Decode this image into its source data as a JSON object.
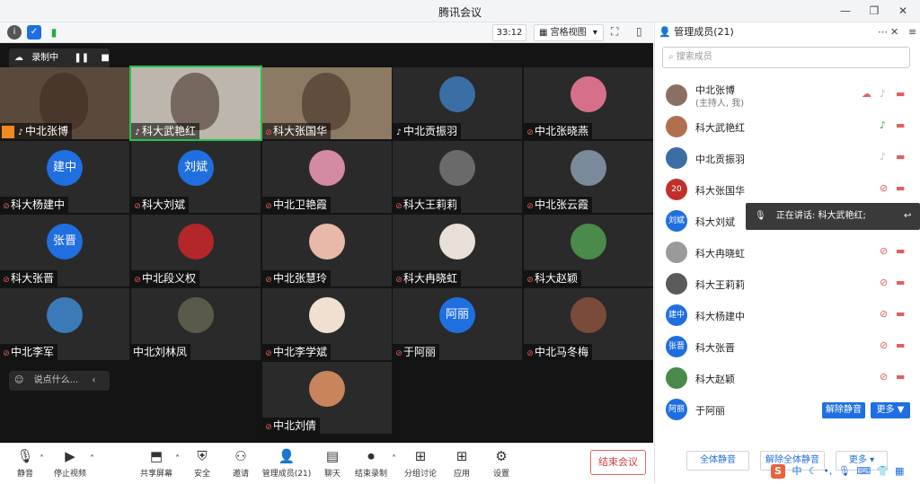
{
  "window": {
    "title": "腾讯会议"
  },
  "toolbar": {
    "timer": "33:12",
    "view_label": "宫格视图"
  },
  "recording": {
    "label": "录制中"
  },
  "tiles": [
    {
      "name": "中北张博",
      "type": "video",
      "bg": "#5a4a3c",
      "mic": "active"
    },
    {
      "name": "科大武艳红",
      "type": "video",
      "bg": "#bdb6ad",
      "mic": "active"
    },
    {
      "name": "科大张国华",
      "type": "video",
      "bg": "#8c7a64",
      "mic": "muted"
    },
    {
      "name": "中北贡振羽",
      "type": "avatar",
      "avatar_text": "",
      "bg": "#3b6ea5",
      "mic": "active"
    },
    {
      "name": "中北张晓燕",
      "type": "avatar",
      "avatar_text": "",
      "bg": "#d6708a",
      "mic": "muted"
    },
    {
      "name": "科大杨建中",
      "type": "avatar",
      "avatar_text": "建中",
      "bg": "#1f6fe0",
      "mic": "muted"
    },
    {
      "name": "科大刘斌",
      "type": "avatar",
      "avatar_text": "刘斌",
      "bg": "#1f6fe0",
      "mic": "muted"
    },
    {
      "name": "中北卫艳霞",
      "type": "avatar",
      "avatar_text": "",
      "bg": "#d48aa2",
      "mic": "muted"
    },
    {
      "name": "科大王莉莉",
      "type": "avatar",
      "avatar_text": "",
      "bg": "#6a6a6a",
      "mic": "muted"
    },
    {
      "name": "中北张云霞",
      "type": "avatar",
      "avatar_text": "",
      "bg": "#7a8a9a",
      "mic": "muted"
    },
    {
      "name": "科大张晋",
      "type": "avatar",
      "avatar_text": "张晋",
      "bg": "#1f6fe0",
      "mic": "muted"
    },
    {
      "name": "中北段义权",
      "type": "avatar",
      "avatar_text": "",
      "bg": "#b3262a",
      "mic": "muted"
    },
    {
      "name": "中北张慧玲",
      "type": "avatar",
      "avatar_text": "",
      "bg": "#e8b8a8",
      "mic": "muted"
    },
    {
      "name": "科大冉晓虹",
      "type": "avatar",
      "avatar_text": "",
      "bg": "#e8e0d8",
      "mic": "muted"
    },
    {
      "name": "科大赵颖",
      "type": "avatar",
      "avatar_text": "",
      "bg": "#4a8a4a",
      "mic": "muted"
    },
    {
      "name": "中北李军",
      "type": "avatar",
      "avatar_text": "",
      "bg": "#3a7ab8",
      "mic": "muted"
    },
    {
      "name": "中北刘林凤",
      "type": "avatar",
      "avatar_text": "",
      "bg": "#5a5a4a",
      "mic": "none"
    },
    {
      "name": "中北李学斌",
      "type": "avatar",
      "avatar_text": "",
      "bg": "#f0e0d0",
      "mic": "muted"
    },
    {
      "name": "于阿丽",
      "type": "avatar",
      "avatar_text": "阿丽",
      "bg": "#1f6fe0",
      "mic": "muted"
    },
    {
      "name": "中北马冬梅",
      "type": "avatar",
      "avatar_text": "",
      "bg": "#7a4a3a",
      "mic": "muted"
    },
    {
      "name": "中北刘倩",
      "type": "avatar",
      "avatar_text": "",
      "bg": "#c8845a",
      "mic": "muted"
    }
  ],
  "chat": {
    "placeholder": "说点什么..."
  },
  "bottombar": {
    "mute": "静音",
    "stop_video": "停止视频",
    "share": "共享屏幕",
    "security": "安全",
    "invite": "邀请",
    "members": "管理成员(21)",
    "chat": "聊天",
    "end_record": "结束录制",
    "breakout": "分组讨论",
    "apps": "应用",
    "settings": "设置",
    "end_meeting": "结束会议"
  },
  "panel": {
    "title": "管理成员(21)",
    "search_placeholder": "搜索成员",
    "members": [
      {
        "name": "中北张博",
        "sub": "(主持人, 我)",
        "avatar_text": "",
        "bg": "#8a7060",
        "mic": "off"
      },
      {
        "name": "科大武艳红",
        "sub": "",
        "avatar_text": "",
        "bg": "#b07050",
        "mic": "on"
      },
      {
        "name": "中北贡振羽",
        "sub": "",
        "avatar_text": "",
        "bg": "#3b6ea5",
        "mic": "off"
      },
      {
        "name": "科大张国华",
        "sub": "",
        "avatar_text": "20",
        "bg": "#c0302a",
        "mic": "muted"
      },
      {
        "name": "科大刘斌",
        "sub": "",
        "avatar_text": "刘斌",
        "bg": "#1f6fe0",
        "mic": "muted"
      },
      {
        "name": "科大冉晓虹",
        "sub": "",
        "avatar_text": "",
        "bg": "#9a9a9a",
        "mic": "muted"
      },
      {
        "name": "科大王莉莉",
        "sub": "",
        "avatar_text": "",
        "bg": "#5a5a5a",
        "mic": "muted"
      },
      {
        "name": "科大杨建中",
        "sub": "",
        "avatar_text": "建中",
        "bg": "#1f6fe0",
        "mic": "muted"
      },
      {
        "name": "科大张晋",
        "sub": "",
        "avatar_text": "张晋",
        "bg": "#1f6fe0",
        "mic": "muted"
      },
      {
        "name": "科大赵颖",
        "sub": "",
        "avatar_text": "",
        "bg": "#4a8a4a",
        "mic": "muted"
      },
      {
        "name": "于阿丽",
        "sub": "",
        "avatar_text": "阿丽",
        "bg": "#1f6fe0",
        "mic": "none"
      }
    ],
    "tooltip": "正在讲话: 科大武艳红;",
    "unmute_button": "解除静音",
    "more_button": "更多 ▼",
    "footer_mute_all": "全体静音",
    "footer_unmute_all": "解除全体静音",
    "footer_more": "更多 ▾"
  },
  "ime": {
    "label": "中"
  },
  "colors": {
    "accent": "#1f6fe0",
    "danger": "#d04040",
    "stage": "#141414"
  }
}
